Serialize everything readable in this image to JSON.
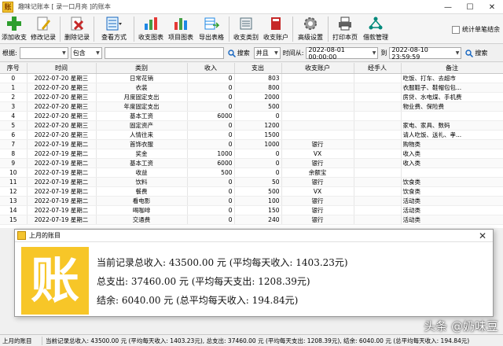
{
  "window": {
    "title": "趣味记账本 [ 录一口月亮 ]的账本",
    "minimize": "—",
    "maximize": "☐",
    "close": "✕"
  },
  "toolbar": {
    "items": [
      {
        "label": "添加收支",
        "icon": "add-icon",
        "color": "#2e9e2e"
      },
      {
        "label": "修改记录",
        "icon": "edit-icon",
        "color": "#d9a400"
      },
      {
        "label": "删除记录",
        "icon": "delete-icon",
        "color": "#c62828"
      },
      {
        "label": "查看方式",
        "icon": "view-mode-icon",
        "color": "#1565c0"
      },
      {
        "label": "收支图表",
        "icon": "bar-chart-icon",
        "color": "#1e88e5"
      },
      {
        "label": "项目图表",
        "icon": "pie-chart-icon",
        "color": "#43a047"
      },
      {
        "label": "导出表格",
        "icon": "export-table-icon",
        "color": "#1e88e5"
      },
      {
        "label": "收支类别",
        "icon": "category-icon",
        "color": "#546e7a"
      },
      {
        "label": "收支账户",
        "icon": "account-book-icon",
        "color": "#c62828"
      },
      {
        "label": "高级设置",
        "icon": "settings-icon",
        "color": "#616161"
      },
      {
        "label": "打印本页",
        "icon": "printer-icon",
        "color": "#424242"
      },
      {
        "label": "借款管理",
        "icon": "loan-icon",
        "color": "#00897b"
      }
    ],
    "checkbox_label": "统计单笔结余"
  },
  "filter": {
    "label_by": "根据:",
    "field_select": "",
    "match_select": "包含",
    "keyword": "",
    "search_label": "搜索",
    "logic_select": "并且",
    "time_from_label": "时间从:",
    "time_from": "2022-08-01 00:00:00",
    "time_to_label": "到",
    "time_to": "2022-08-10 23:59:59",
    "search2_label": "搜索"
  },
  "table": {
    "headers": [
      "序号",
      "时间",
      "类别",
      "收入",
      "支出",
      "收支账户",
      "经手人",
      "备注"
    ],
    "rows": [
      [
        "0",
        "2022-07-20 星期三",
        "日常花销",
        "0",
        "803",
        "",
        "",
        "吃饭、打车、去超市"
      ],
      [
        "1",
        "2022-07-20 星期三",
        "衣装",
        "0",
        "800",
        "",
        "",
        "衣服鞋子、鞋帽包包..."
      ],
      [
        "2",
        "2022-07-20 星期三",
        "月度固定支出",
        "0",
        "2000",
        "",
        "",
        "房贷、水电煤、手机费"
      ],
      [
        "3",
        "2022-07-20 星期三",
        "年度固定支出",
        "0",
        "500",
        "",
        "",
        "物业费、保险费"
      ],
      [
        "4",
        "2022-07-20 星期三",
        "基本工资",
        "6000",
        "0",
        "",
        "",
        ""
      ],
      [
        "5",
        "2022-07-20 星期三",
        "固定资产",
        "0",
        "1200",
        "",
        "",
        "家电、家具、数码"
      ],
      [
        "6",
        "2022-07-20 星期三",
        "人情往来",
        "0",
        "1500",
        "",
        "",
        "请人吃饭、送礼、孝..."
      ],
      [
        "7",
        "2022-07-19 星期二",
        "首饰衣服",
        "0",
        "1000",
        "银行",
        "",
        "购物类"
      ],
      [
        "8",
        "2022-07-19 星期二",
        "奖金",
        "1000",
        "0",
        "VX",
        "",
        "收入类"
      ],
      [
        "9",
        "2022-07-19 星期二",
        "基本工资",
        "6000",
        "0",
        "银行",
        "",
        "收入类"
      ],
      [
        "10",
        "2022-07-19 星期二",
        "收益",
        "500",
        "0",
        "余额宝",
        "",
        ""
      ],
      [
        "11",
        "2022-07-19 星期二",
        "饮料",
        "0",
        "50",
        "银行",
        "",
        "饮食类"
      ],
      [
        "12",
        "2022-07-19 星期二",
        "餐费",
        "0",
        "500",
        "VX",
        "",
        "饮食类"
      ],
      [
        "13",
        "2022-07-19 星期二",
        "看电影",
        "0",
        "100",
        "银行",
        "",
        "活动类"
      ],
      [
        "14",
        "2022-07-19 星期二",
        "喝咖啡",
        "0",
        "150",
        "银行",
        "",
        "活动类"
      ],
      [
        "15",
        "2022-07-19 星期二",
        "交通费",
        "0",
        "240",
        "银行",
        "",
        "活动类"
      ]
    ]
  },
  "popup": {
    "title": "上月的账目",
    "badge_char": "账",
    "close": "✕",
    "line1": "当前记录总收入: 43500.00 元 (平均每天收入: 1403.23元)",
    "line2": "总支出: 37460.00 元 (平均每天支出: 1208.39元)",
    "line3": "结余: 6040.00 元 (总平均每天收入: 194.84元)"
  },
  "status": {
    "left": "上月的账目",
    "right": "当前记录总收入: 43500.00 元 (平均每天收入: 1403.23元), 总支出: 37460.00 元 (平均每天支出: 1208.39元), 结余: 6040.00 元 (总平均每天收入: 194.84元)"
  },
  "watermark": "头条 @奶味豆"
}
